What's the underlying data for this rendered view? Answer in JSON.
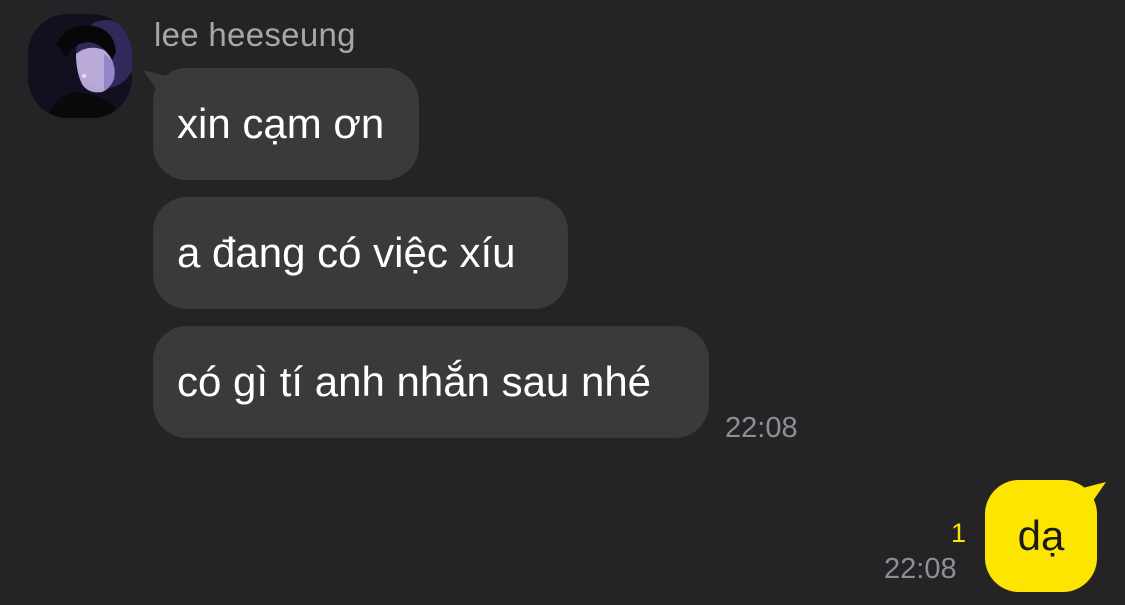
{
  "contact": {
    "name": "lee heeseung",
    "avatar_icon": "profile-photo"
  },
  "incoming_messages": [
    {
      "text": "xin cạm ơn"
    },
    {
      "text": "a đang có việc xíu"
    },
    {
      "text": "có gì tí anh nhắn sau nhé"
    }
  ],
  "incoming_time": "22:08",
  "outgoing_message": {
    "text": "dạ",
    "unread_count": "1",
    "time": "22:08"
  },
  "colors": {
    "background": "#242426",
    "incoming_bubble": "#3a3a3c",
    "outgoing_bubble": "#fee500",
    "timestamp": "#8e8e93"
  }
}
